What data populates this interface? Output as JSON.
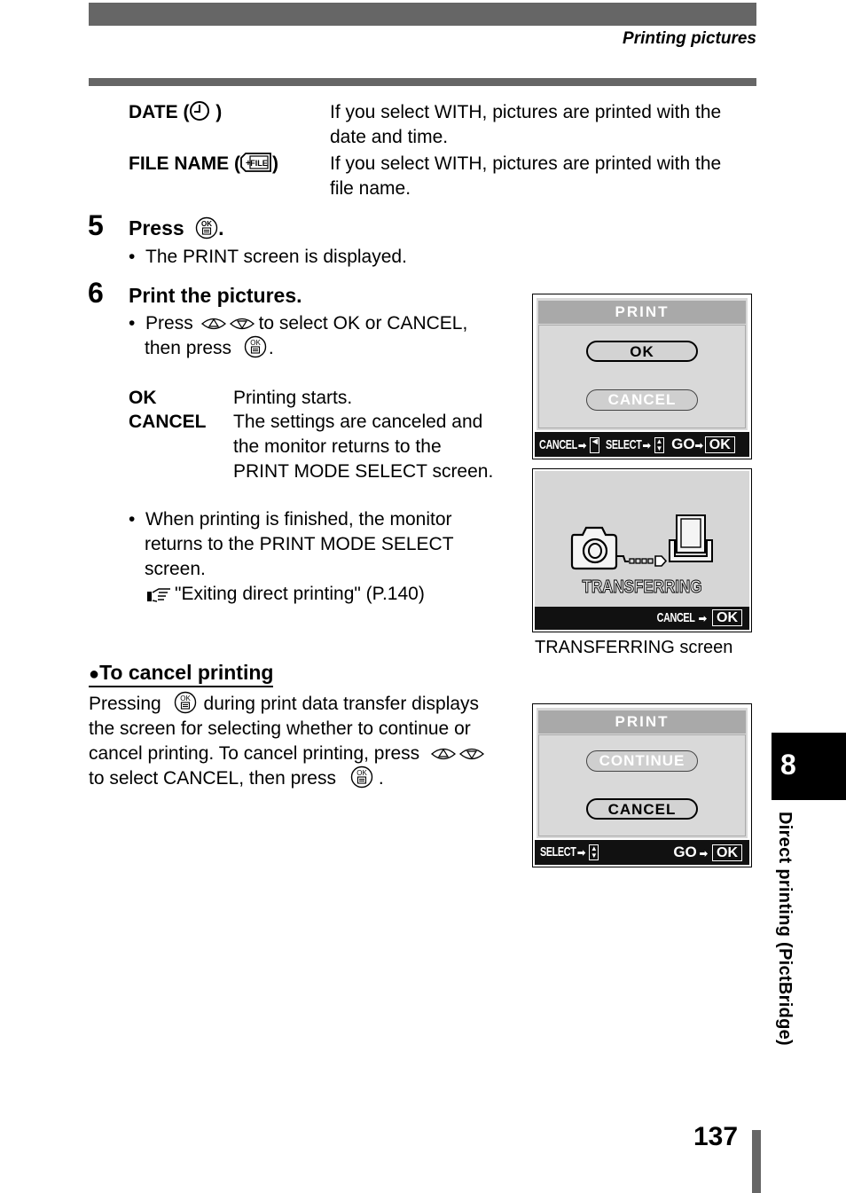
{
  "header": {
    "section_title": "Printing pictures"
  },
  "options": [
    {
      "label": "DATE (",
      "icon": "clock-icon",
      "label_close": " )",
      "description": "If you select WITH, pictures are printed with the date and time.",
      "desc_line1": "If you select WITH, pictures are printed with the",
      "desc_line2": "date and time."
    },
    {
      "label": "FILE NAME (",
      "icon": "file-icon",
      "label_close": ")",
      "description": "If you select WITH, pictures are printed with the file name.",
      "desc_line1": "If you select WITH, pictures are printed with the",
      "desc_line2": "file name."
    }
  ],
  "steps": [
    {
      "number": "5",
      "title": "Press",
      "title_suffix": ".",
      "bullets": [
        "The PRINT screen is displayed."
      ]
    },
    {
      "number": "6",
      "title": "Print the pictures.",
      "bullet1_a": "Press",
      "bullet1_b": "to select OK or CANCEL,",
      "bullet1_c": "then press",
      "bullet1_d": ".",
      "defs": [
        {
          "term": "OK",
          "lines": [
            "Printing starts."
          ]
        },
        {
          "term": "CANCEL",
          "lines": [
            "The settings are canceled and",
            "the monitor returns to the",
            "PRINT MODE SELECT screen."
          ]
        }
      ],
      "bullet2_lines": [
        "When printing is finished, the monitor",
        "returns to the PRINT MODE SELECT",
        "screen."
      ],
      "reference": "\"Exiting direct printing\" (P.140)"
    }
  ],
  "cancel_section": {
    "heading": "To cancel printing",
    "line1_a": "Pressing",
    "line1_b": "during print data transfer displays",
    "line2": "the screen for selecting whether to continue or",
    "line3": "cancel printing. To cancel printing, press",
    "line4_a": "to select CANCEL, then press",
    "line4_b": "."
  },
  "screens": {
    "print": {
      "title": "PRINT",
      "options": [
        "OK",
        "CANCEL"
      ],
      "selected": "OK",
      "footer": {
        "cancel": "CANCEL",
        "select": "SELECT",
        "go": "GO",
        "ok": "OK"
      }
    },
    "transferring": {
      "status": "TRANSFERRING",
      "footer": {
        "cancel": "CANCEL",
        "ok": "OK"
      },
      "caption": "TRANSFERRING screen"
    },
    "print_continue": {
      "title": "PRINT",
      "options": [
        "CONTINUE",
        "CANCEL"
      ],
      "selected": "CANCEL",
      "footer": {
        "select": "SELECT",
        "go": "GO",
        "ok": "OK"
      }
    }
  },
  "side_tab": {
    "chapter": "8",
    "chapter_title": "Direct printing (PictBridge)"
  },
  "page_number": "137"
}
